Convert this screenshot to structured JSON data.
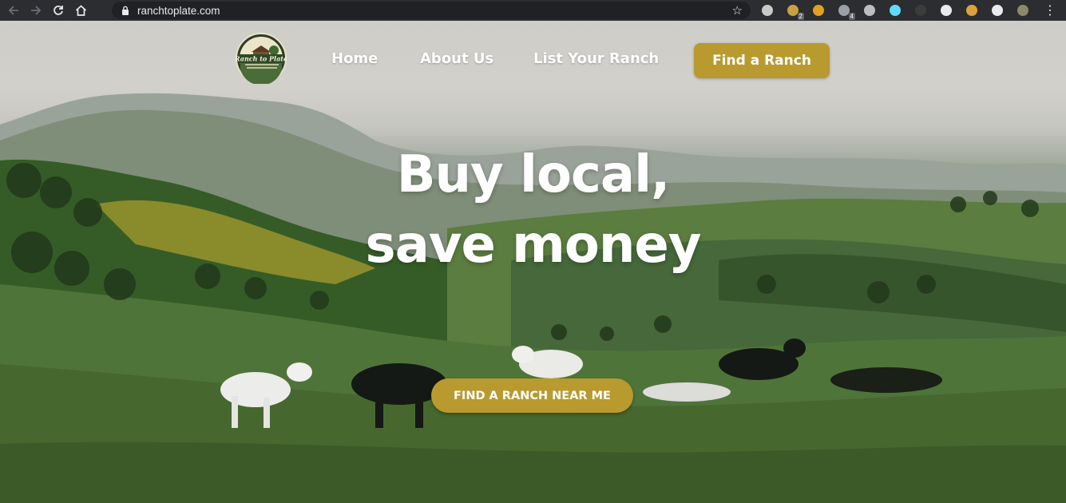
{
  "browser": {
    "url": "ranchtoplate.com",
    "extensions": [
      {
        "icon": "gear-extension-icon",
        "color": "#c9c9c9",
        "badge": ""
      },
      {
        "icon": "abp-extension-icon",
        "color": "#c8a240",
        "badge": "2"
      },
      {
        "icon": "hand-extension-icon",
        "color": "#e0a21e",
        "badge": ""
      },
      {
        "icon": "ublock-extension-icon",
        "color": "#9aa0a6",
        "badge": "4"
      },
      {
        "icon": "target-extension-icon",
        "color": "#bdbdbd",
        "badge": ""
      },
      {
        "icon": "react-extension-icon",
        "color": "#61dafb",
        "badge": ""
      },
      {
        "icon": "dark-circle-extension-icon",
        "color": "#3c3c3c",
        "badge": ""
      },
      {
        "icon": "half-circle-extension-icon",
        "color": "#e8eaed",
        "badge": ""
      },
      {
        "icon": "box-extension-icon",
        "color": "#d8a43a",
        "badge": ""
      },
      {
        "icon": "puzzle-extension-icon",
        "color": "#e8eaed",
        "badge": ""
      },
      {
        "icon": "profile-avatar-icon",
        "color": "#8a8a6a",
        "badge": ""
      }
    ]
  },
  "site": {
    "logo_text": "Ranch to Plate",
    "nav": [
      {
        "label": "Home"
      },
      {
        "label": "About Us"
      },
      {
        "label": "List Your Ranch"
      }
    ],
    "nav_cta": "Find a Ranch",
    "headline_line1": "Buy local,",
    "headline_line2": "save money",
    "hero_cta": "FIND A RANCH NEAR ME"
  },
  "colors": {
    "accent": "#b99a2e",
    "chrome_bg": "#2b2d30",
    "omnibox_bg": "#202124"
  }
}
